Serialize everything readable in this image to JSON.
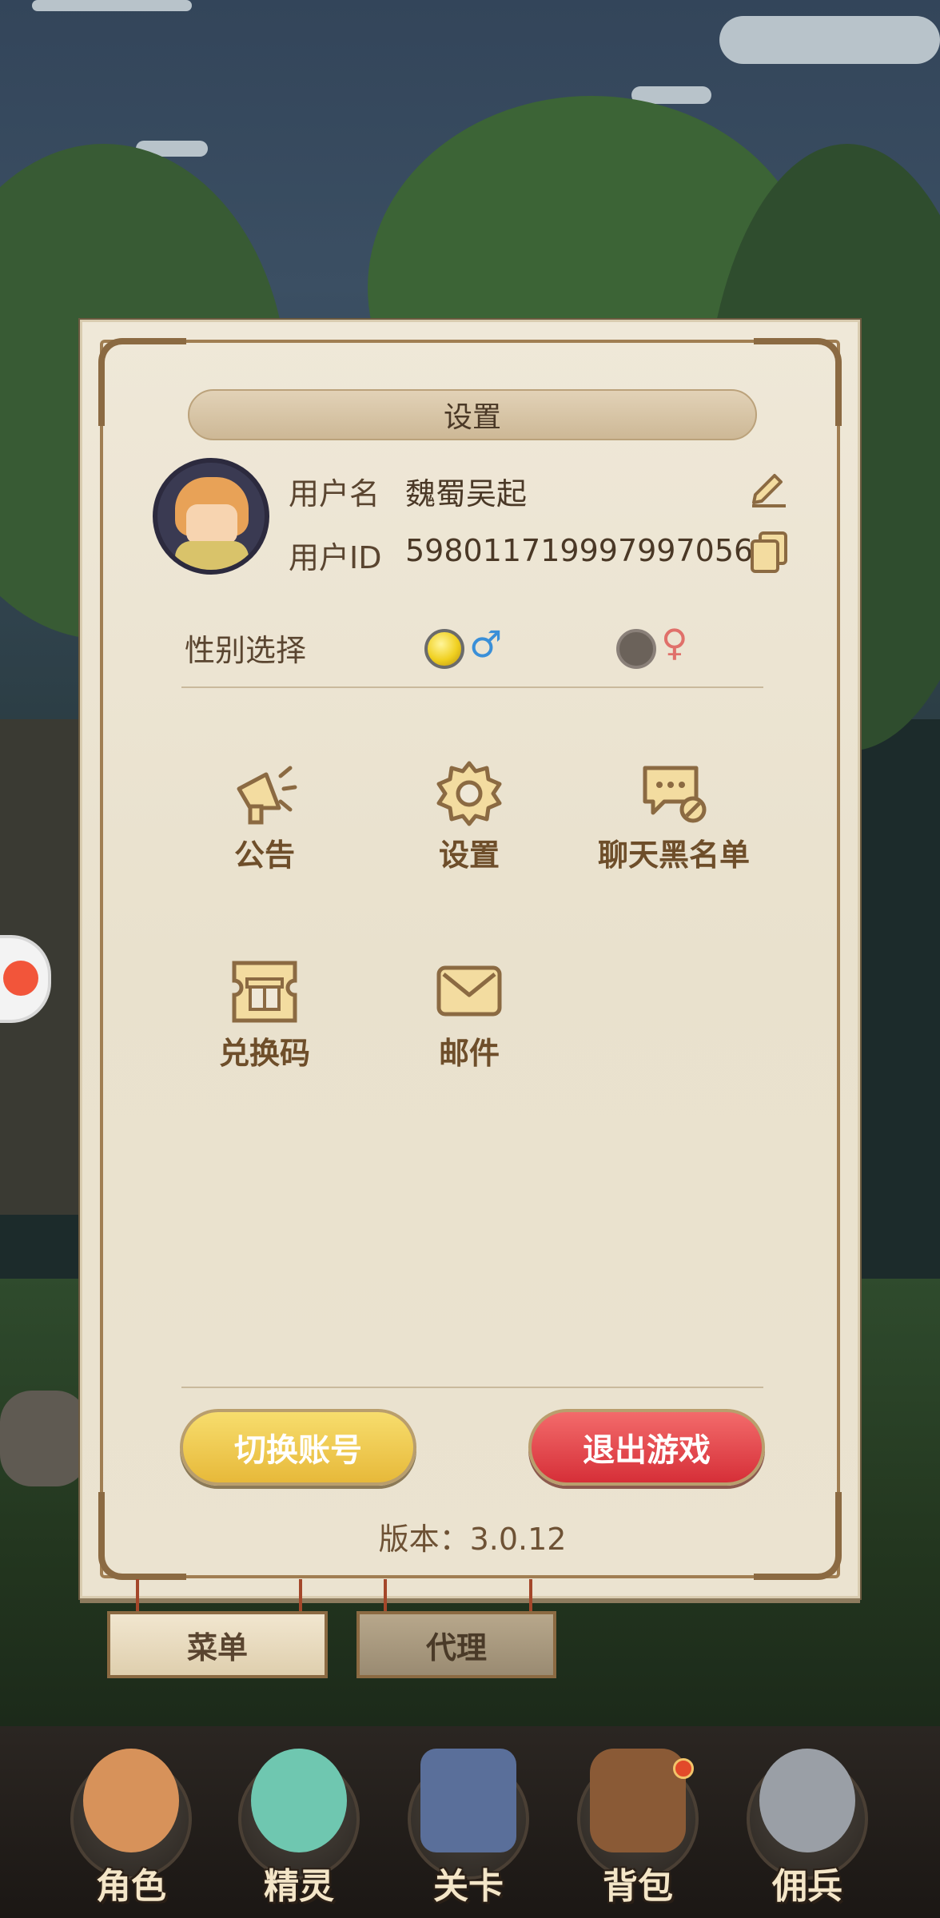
{
  "panel": {
    "title": "设置",
    "profile": {
      "username_label": "用户名",
      "username": "魏蜀吴起",
      "userid_label": "用户ID",
      "userid": "598011719997997056"
    },
    "gender": {
      "label": "性别选择",
      "male_symbol": "♂",
      "female_symbol": "♀",
      "selected": "male"
    },
    "menu_items": [
      {
        "label": "公告",
        "icon": "megaphone-icon"
      },
      {
        "label": "设置",
        "icon": "gear-icon"
      },
      {
        "label": "聊天黑名单",
        "icon": "chat-block-icon"
      },
      {
        "label": "兑换码",
        "icon": "gift-ticket-icon"
      },
      {
        "label": "邮件",
        "icon": "mail-icon"
      }
    ],
    "buttons": {
      "switch_account": "切换账号",
      "exit_game": "退出游戏"
    },
    "version": "版本：3.0.12"
  },
  "signs": {
    "menu": "菜单",
    "proxy": "代理"
  },
  "bottom_tabs": [
    {
      "label": "角色",
      "icon": "character-icon"
    },
    {
      "label": "精灵",
      "icon": "spirit-icon"
    },
    {
      "label": "关卡",
      "icon": "stage-icon"
    },
    {
      "label": "背包",
      "icon": "backpack-icon"
    },
    {
      "label": "佣兵",
      "icon": "mercenary-icon"
    }
  ],
  "colors": {
    "panel_bg": "#efe8d8",
    "accent_brown": "#8b6a42",
    "yellow_button": "#f0c94a",
    "red_button": "#e0414a",
    "male_color": "#3a8fd8",
    "female_color": "#e0706a"
  }
}
